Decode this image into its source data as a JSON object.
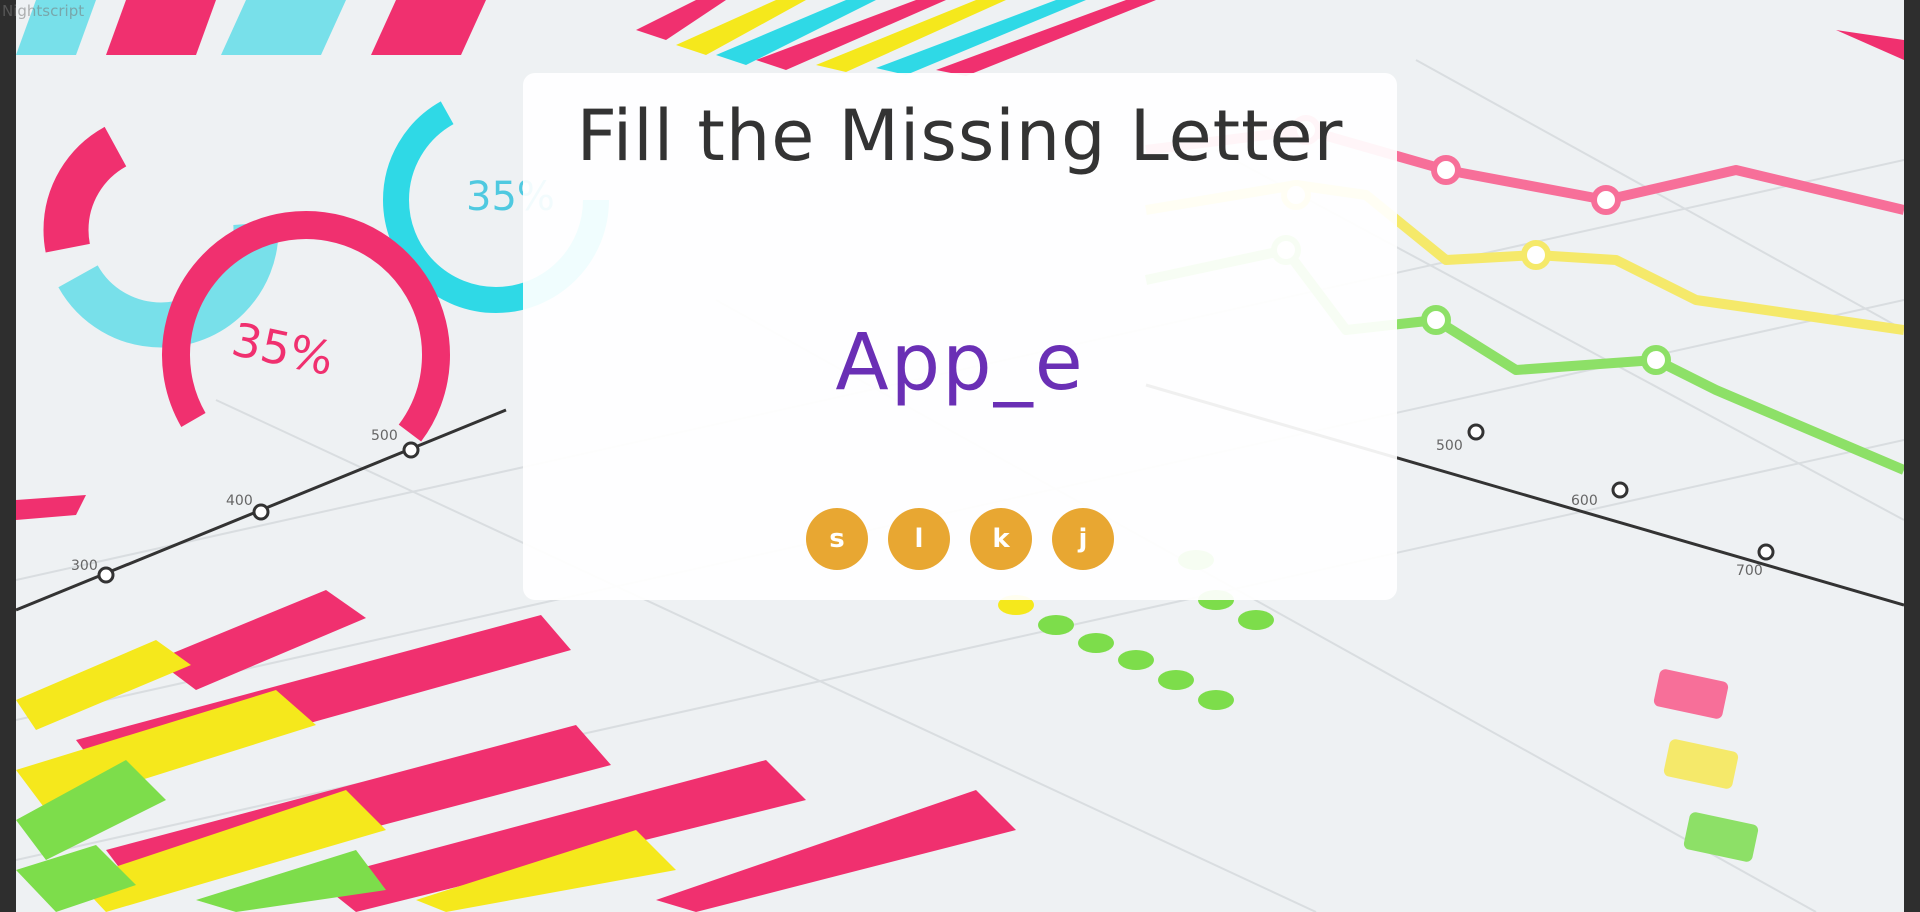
{
  "tab": {
    "ghost_label": "Nightscript"
  },
  "game": {
    "title": "Fill the Missing Letter",
    "word": "App_e",
    "options": [
      "s",
      "l",
      "k",
      "j"
    ]
  },
  "background": {
    "percent_labels": [
      "35%",
      "35%"
    ],
    "axis_ticks_left": [
      "300",
      "400",
      "500"
    ],
    "axis_ticks_right": [
      "500",
      "600",
      "700"
    ]
  },
  "colors": {
    "accent_purple": "#6a2fb5",
    "option_orange": "#e8a732",
    "pink": "#f0306f",
    "yellow": "#f5e81c",
    "green": "#7ddd4b",
    "cyan": "#2fd9e6"
  }
}
